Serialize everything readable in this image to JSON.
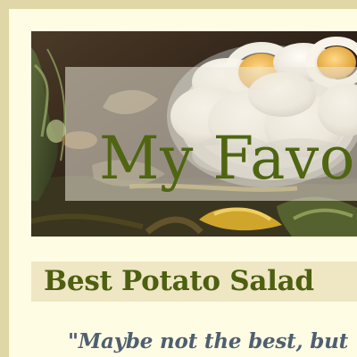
{
  "header": {
    "title": "My Favo"
  },
  "hero_image": {
    "icon": "food-still-life-image"
  },
  "recipe": {
    "title": "Best Potato Salad",
    "quote": "\"Maybe not the best, but"
  },
  "colors": {
    "outer_background": "#dfd7a8",
    "page_background": "#fffce4",
    "title_text": "#4f6512",
    "recipe_bar": "#efe6c4",
    "quote_text": "#4f5f6f"
  }
}
